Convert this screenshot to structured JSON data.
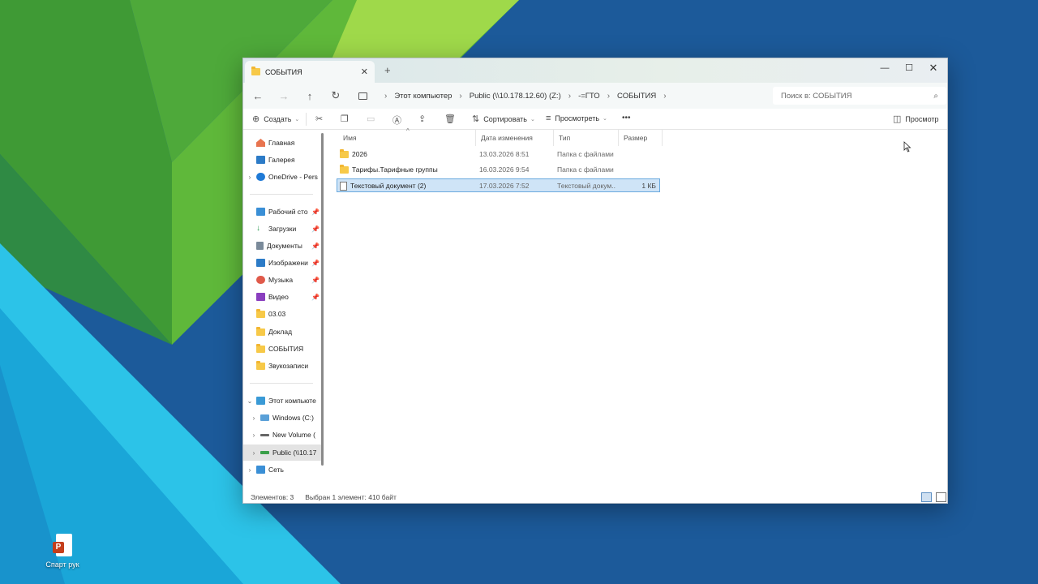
{
  "desktop": {
    "icons": [
      {
        "label": "Спарт рук",
        "icon": "powerpoint-file-icon"
      }
    ]
  },
  "window": {
    "tab_title": "СОБЫТИЯ",
    "new_tab_symbol": "+",
    "tab_close_symbol": "✕",
    "controls": {
      "minimize": "—",
      "maximize": "☐",
      "close": "✕"
    }
  },
  "address": {
    "crumbs": [
      "Этот компьютер",
      "Public (\\\\10.178.12.60) (Z:)",
      "-=ГТО",
      "СОБЫТИЯ"
    ],
    "search_placeholder": "Поиск в: СОБЫТИЯ"
  },
  "toolbar": {
    "create": "Создать",
    "sort": "Сортировать",
    "view": "Просмотреть",
    "more": "•••",
    "preview": "Просмотр"
  },
  "sidebar": {
    "home": "Главная",
    "gallery": "Галерея",
    "onedrive": "OneDrive - Pers",
    "quick": [
      {
        "label": "Рабочий сто",
        "pinned": true
      },
      {
        "label": "Загрузки",
        "pinned": true
      },
      {
        "label": "Документы",
        "pinned": true
      },
      {
        "label": "Изображени",
        "pinned": true
      },
      {
        "label": "Музыка",
        "pinned": true
      },
      {
        "label": "Видео",
        "pinned": true
      },
      {
        "label": "03.03",
        "pinned": false
      },
      {
        "label": "Доклад",
        "pinned": false
      },
      {
        "label": "СОБЫТИЯ",
        "pinned": false
      },
      {
        "label": "Звукозаписи",
        "pinned": false
      }
    ],
    "this_pc": "Этот компьюте",
    "drives": [
      {
        "label": "Windows (C:)"
      },
      {
        "label": "New Volume ("
      },
      {
        "label": "Public (\\\\10.17"
      }
    ],
    "network": "Сеть",
    "pin_symbol": "📌"
  },
  "columns": {
    "name": "Имя",
    "date": "Дата изменения",
    "type": "Тип",
    "size": "Размер"
  },
  "files": [
    {
      "name": "2026",
      "date": "13.03.2026 8:51",
      "type": "Папка с файлами",
      "size": "",
      "kind": "folder",
      "selected": false
    },
    {
      "name": "Тарифы.Тарифные группы",
      "date": "16.03.2026 9:54",
      "type": "Папка с файлами",
      "size": "",
      "kind": "folder",
      "selected": false
    },
    {
      "name": "Текстовый документ (2)",
      "date": "17.03.2026 7:52",
      "type": "Текстовый докум...",
      "size": "1 КБ",
      "kind": "text",
      "selected": true
    }
  ],
  "status": {
    "count": "Элементов: 3",
    "selection": "Выбран 1 элемент: 410 байт"
  },
  "colors": {
    "selection_fill": "#cfe4f7",
    "selection_border": "#6aa9de",
    "wallpaper_blue": "#1c5a9a",
    "wallpaper_green": "#5fb83a",
    "wallpaper_cyan": "#2cc3e8"
  }
}
